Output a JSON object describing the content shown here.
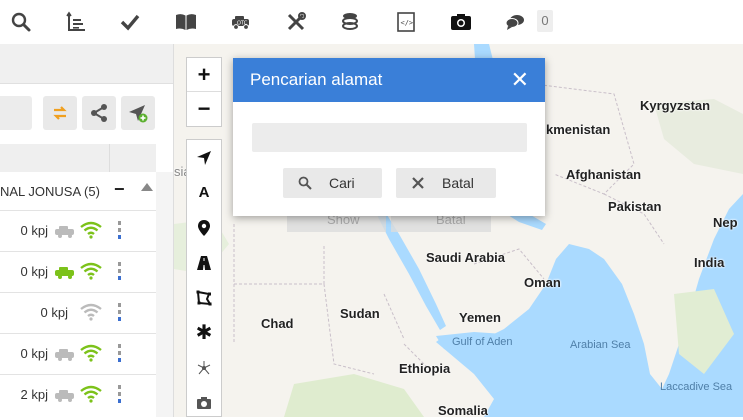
{
  "toolbar": {
    "icons": [
      "search-icon",
      "axis-chart-icon",
      "check-icon",
      "book-icon",
      "vehicle-icon",
      "tools-icon",
      "coins-icon",
      "code-file-icon",
      "camera-icon",
      "chat-icon"
    ],
    "message_count": "0"
  },
  "left_panel": {
    "group_label": "NAL JONUSA (5)",
    "group_collapse": "−",
    "rows": [
      {
        "speed": "0 kpj",
        "car_color": "#bbbbbb",
        "wifi_color": "#7cc21a",
        "status_colors": [
          "#999999",
          "#999999",
          "#3b6fd0"
        ]
      },
      {
        "speed": "0 kpj",
        "car_color": "#7cc21a",
        "wifi_color": "#7cc21a",
        "status_colors": [
          "#999999",
          "#999999",
          "#3b6fd0"
        ]
      },
      {
        "speed": "0 kpj",
        "car_color": "",
        "wifi_color": "#bbbbbb",
        "status_colors": [
          "#999999",
          "#999999",
          "#3b6fd0"
        ]
      },
      {
        "speed": "0 kpj",
        "car_color": "#bbbbbb",
        "wifi_color": "#7cc21a",
        "status_colors": [
          "#999999",
          "#999999",
          "#3b6fd0"
        ]
      },
      {
        "speed": "2 kpj",
        "car_color": "#bbbbbb",
        "wifi_color": "#7cc21a",
        "status_colors": [
          "#999999",
          "#999999",
          "#3b6fd0"
        ]
      }
    ]
  },
  "map": {
    "controls": {
      "zoom_in": "+",
      "zoom_out": "−"
    },
    "tools": [
      "navigate-icon",
      "text-icon",
      "pin-icon",
      "road-icon",
      "polygon-icon",
      "asterisk-icon",
      "network-icon",
      "camera-icon"
    ],
    "tool_glyphs": {
      "text": "A",
      "asterisk": "✱"
    },
    "labels": {
      "kyrgyzstan": "Kyrgyzstan",
      "turkmenistan": "kmenistan",
      "afghanistan": "Afghanistan",
      "pakistan": "Pakistan",
      "india": "India",
      "nepal": "Nep",
      "saudi": "Saudi Arabia",
      "oman": "Oman",
      "yemen": "Yemen",
      "sudan": "Sudan",
      "chad": "Chad",
      "ethiopia": "Ethiopia",
      "somalia": "Somalia",
      "gulf_aden": "Gulf of Aden",
      "arabian_sea": "Arabian Sea",
      "laccadive": "Laccadive Sea",
      "asia_partial": "sia"
    },
    "ghost_buttons": {
      "show": "Show",
      "cancel": "Batal"
    }
  },
  "dialog": {
    "title": "Pencarian alamat",
    "close": "✕",
    "input_value": "",
    "input_placeholder": "",
    "search_button": "Cari",
    "cancel_button": "Batal",
    "header_color": "#3a7fd8"
  }
}
